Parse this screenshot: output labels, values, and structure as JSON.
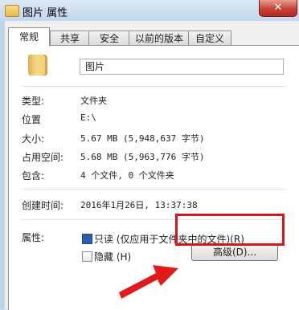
{
  "window": {
    "title": "图片 属性",
    "close_label": "✕"
  },
  "tabs": [
    "常规",
    "共享",
    "安全",
    "以前的版本",
    "自定义"
  ],
  "general": {
    "name": "图片",
    "type_label": "类型:",
    "type_value": "文件夹",
    "location_label": "位置",
    "location_value": "E:\\",
    "size_label": "大小:",
    "size_value": "5.67 MB (5,948,637 字节)",
    "disk_label": "占用空间:",
    "disk_value": "5.68 MB (5,963,776 字节)",
    "contains_label": "包含:",
    "contains_value": "4 个文件, 0 个文件夹",
    "created_label": "创建时间:",
    "created_value": "2016年1月26日, 13:37:38",
    "attributes_label": "属性:",
    "readonly_label": "只读 (仅应用于文件夹中的文件)(R)",
    "hidden_label": "隐藏 (H)",
    "advanced_label": "高级(D)..."
  },
  "colors": {
    "highlight": "#d21919",
    "arrow": "#e11b1b"
  },
  "icons": {
    "folder": "folder-icon",
    "close": "close-icon"
  }
}
